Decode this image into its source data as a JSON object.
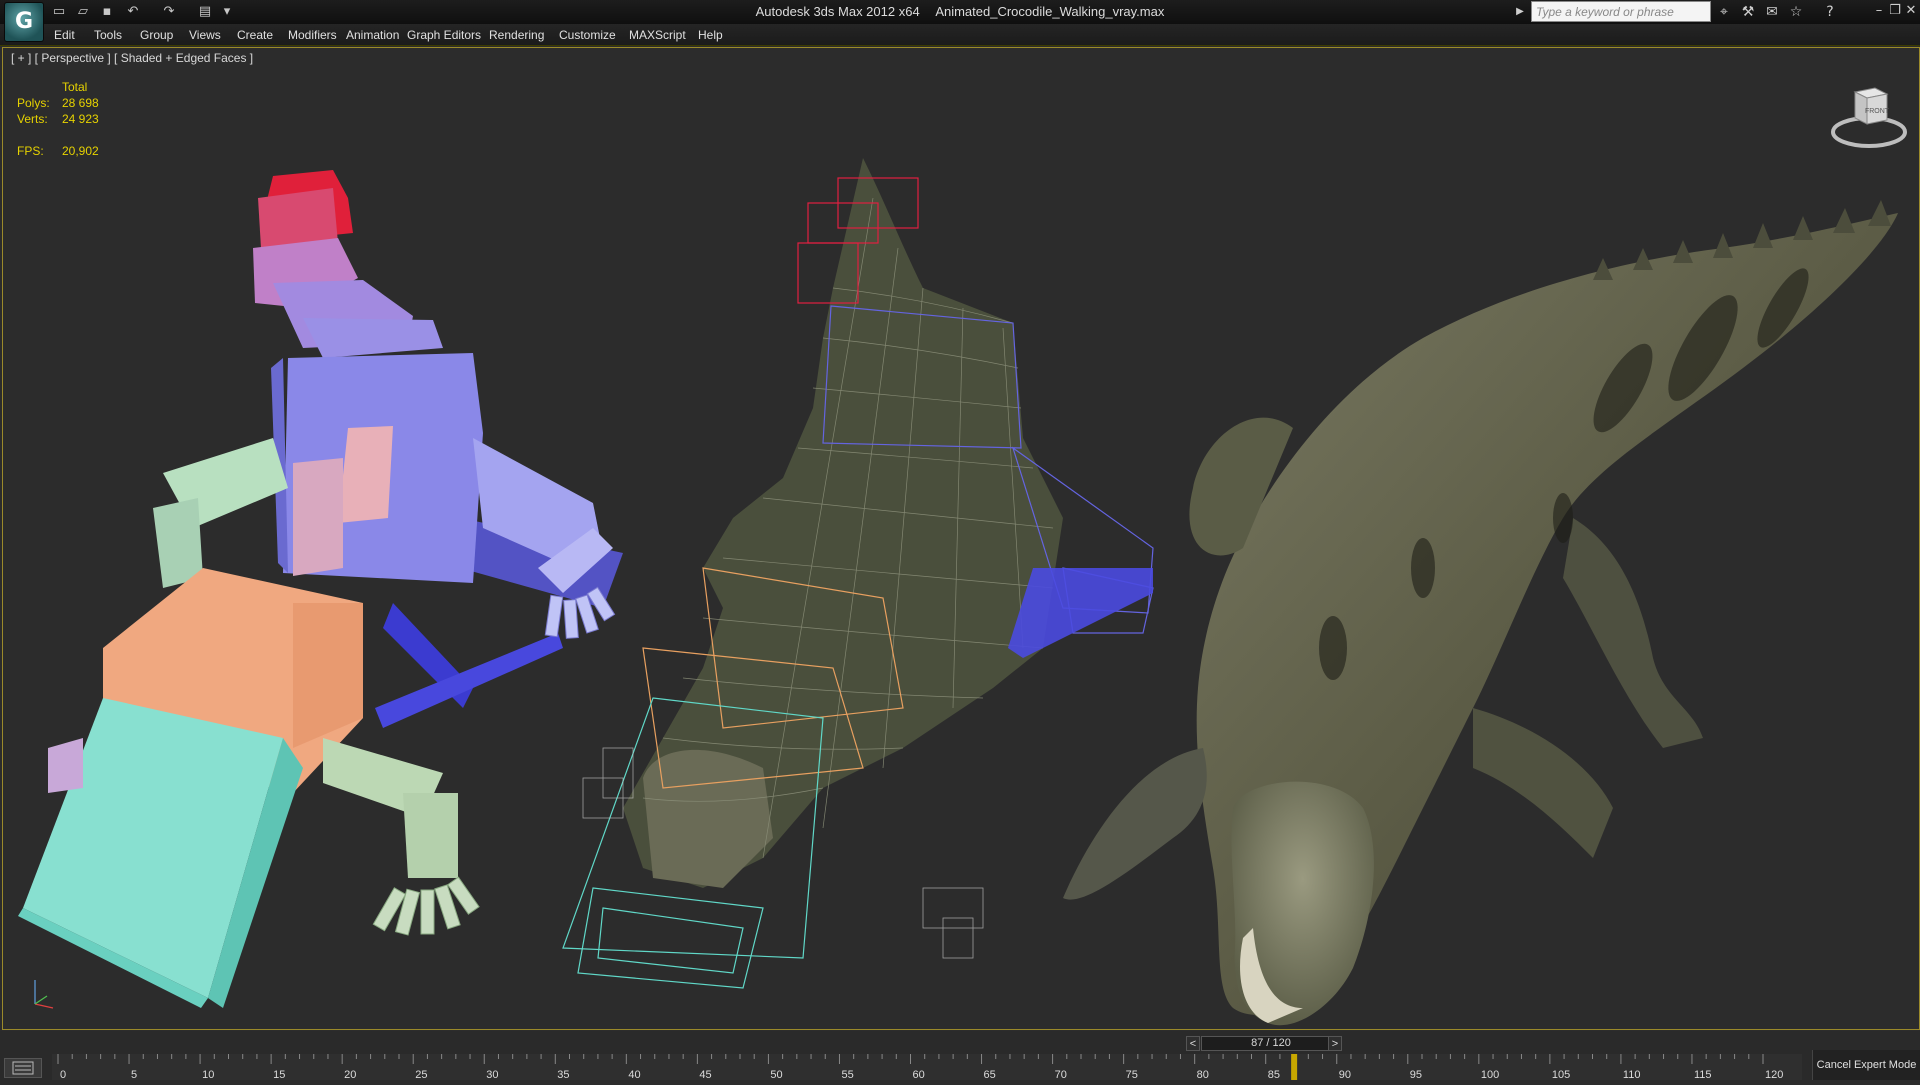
{
  "titlebar": {
    "app_name": "Autodesk 3ds Max  2012 x64",
    "file_name": "Animated_Crocodile_Walking_vray.max",
    "search_placeholder": "Type a keyword or phrase"
  },
  "menu": [
    "Edit",
    "Tools",
    "Group",
    "Views",
    "Create",
    "Modifiers",
    "Animation",
    "Graph Editors",
    "Rendering",
    "Customize",
    "MAXScript",
    "Help"
  ],
  "viewport": {
    "label": "[ + ] [ Perspective ] [ Shaded + Edged Faces ]",
    "stats": {
      "header": "Total",
      "polys_label": "Polys:",
      "polys_value": "28 698",
      "verts_label": "Verts:",
      "verts_value": "24 923",
      "fps_label": "FPS:",
      "fps_value": "20,902"
    },
    "viewcube_label": "FRONT"
  },
  "timeline": {
    "frame_display": "87 / 120",
    "prev": "<",
    "next": ">",
    "current_frame": 87,
    "total_frames": 120,
    "ticks": [
      "0",
      "5",
      "10",
      "15",
      "20",
      "25",
      "30",
      "35",
      "40",
      "45",
      "50",
      "55",
      "60",
      "65",
      "70",
      "75",
      "80",
      "85",
      "90",
      "95",
      "100",
      "105",
      "110",
      "115",
      "120"
    ]
  },
  "status": {
    "expert_mode": "Cancel Expert Mode"
  },
  "colors": {
    "stats_text": "#e6d200",
    "viewport_bg": "#2c2c2c",
    "viewport_border": "#9b8a2a"
  }
}
